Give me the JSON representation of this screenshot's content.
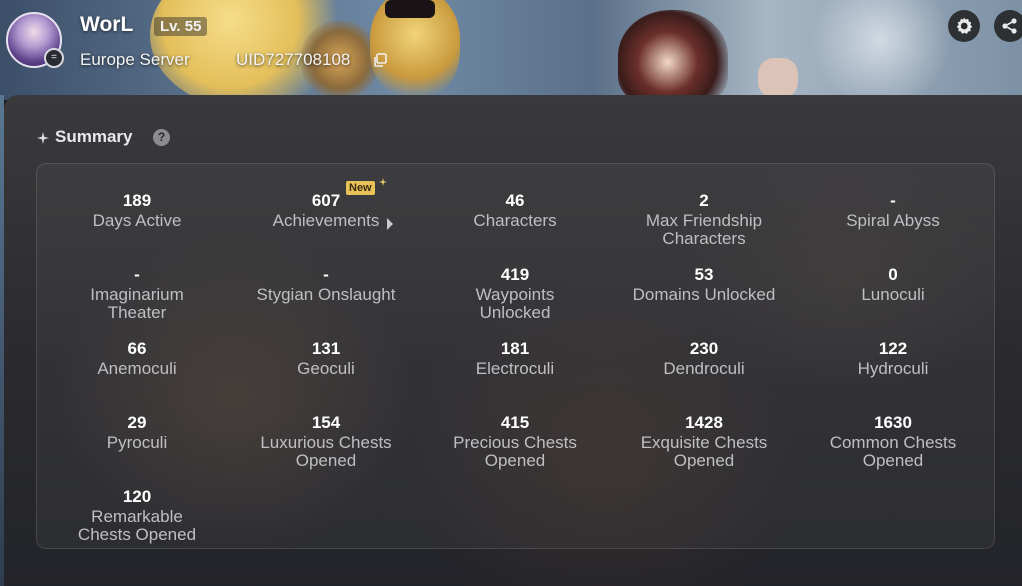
{
  "profile": {
    "username": "WorL",
    "level": "Lv. 55",
    "server": "Europe Server",
    "uid": "UID727708108"
  },
  "summary": {
    "title": "Summary",
    "help_icon": "?",
    "new_badge": "New",
    "stats": [
      {
        "value": "189",
        "label": "Days Active"
      },
      {
        "value": "607",
        "label": "Achievements"
      },
      {
        "value": "46",
        "label": "Characters"
      },
      {
        "value": "2",
        "label": "Max Friendship\nCharacters"
      },
      {
        "value": "-",
        "label": "Spiral Abyss"
      },
      {
        "value": "-",
        "label": "Imaginarium\nTheater"
      },
      {
        "value": "-",
        "label": "Stygian Onslaught"
      },
      {
        "value": "419",
        "label": "Waypoints\nUnlocked"
      },
      {
        "value": "53",
        "label": "Domains Unlocked"
      },
      {
        "value": "0",
        "label": "Lunoculi"
      },
      {
        "value": "66",
        "label": "Anemoculi"
      },
      {
        "value": "131",
        "label": "Geoculi"
      },
      {
        "value": "181",
        "label": "Electroculi"
      },
      {
        "value": "230",
        "label": "Dendroculi"
      },
      {
        "value": "122",
        "label": "Hydroculi"
      },
      {
        "value": "29",
        "label": "Pyroculi"
      },
      {
        "value": "154",
        "label": "Luxurious Chests\nOpened"
      },
      {
        "value": "415",
        "label": "Precious Chests\nOpened"
      },
      {
        "value": "1428",
        "label": "Exquisite Chests\nOpened"
      },
      {
        "value": "1630",
        "label": "Common Chests\nOpened"
      },
      {
        "value": "120",
        "label": "Remarkable\nChests Opened"
      }
    ]
  },
  "colors": {
    "panel_bg": "#2a2a2e",
    "value_text": "#ffffff",
    "label_text": "#bfbfc3",
    "new_badge": "#e8c35a"
  },
  "icons": [
    "avatar",
    "copy-icon",
    "gear-icon",
    "share-icon",
    "sparkle-icon",
    "help-icon",
    "chevron-right-icon",
    "new-star-icon"
  ]
}
